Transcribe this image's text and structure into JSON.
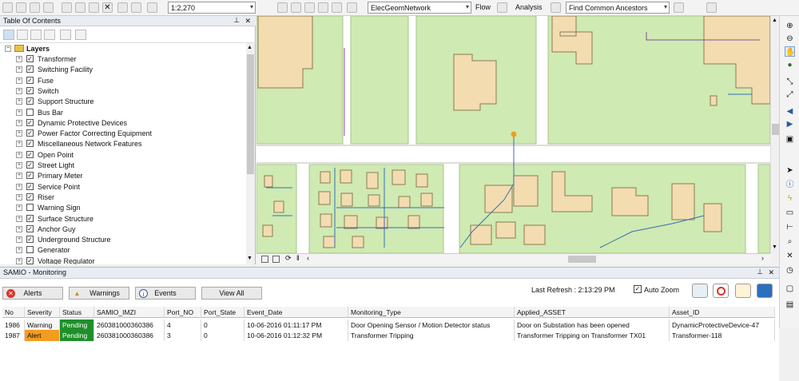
{
  "toolbar": {
    "scale": "1:2,270",
    "network": "ElecGeomNetwork",
    "flow": "Flow",
    "analysis": "Analysis",
    "find": "Find Common Ancestors"
  },
  "toc": {
    "title": "Table Of Contents",
    "pin": "✕",
    "root": "Layers",
    "layers": [
      "Transformer",
      "Switching Facility",
      "Fuse",
      "Switch",
      "Support Structure",
      "Bus Bar",
      "Dynamic Protective Devices",
      "Power Factor Correcting Equipment",
      "Miscellaneous Network Features",
      "Open Point",
      "Street Light",
      "Primary Meter",
      "Service Point",
      "Riser",
      "Warning Sign",
      "Surface Structure",
      "Anchor Guy",
      "Underground Structure",
      "Generator",
      "Voltage Regulator"
    ],
    "unchecked": [
      5,
      14,
      18
    ]
  },
  "monitor": {
    "title": "SAMIO - Monitoring",
    "buttons": {
      "alerts": "Alerts",
      "warnings": "Warnings",
      "events": "Events",
      "view_all": "View All"
    },
    "last_refresh": "Last Refresh : 2:13:29 PM",
    "auto_zoom": "Auto Zoom",
    "columns": [
      "No",
      "Severity",
      "Status",
      "SAMIO_IMZI",
      "Port_NO",
      "Port_State",
      "Event_Date",
      "Monitoring_Type",
      "Applied_ASSET",
      "Asset_ID"
    ],
    "rows": [
      [
        "1986",
        "Warning",
        "Pending",
        "260381000360386",
        "4",
        "0",
        "10-06-2016 01:11:17 PM",
        "Door Opening Sensor / Motion Detector status",
        "Door on Substation  has been opened",
        "DynamicProtectiveDevice-47"
      ],
      [
        "1987",
        "Alert",
        "Pending",
        "260381000360386",
        "3",
        "0",
        "10-06-2016 01:12:32 PM",
        "Transformer Tripping",
        "Transformer Tripping on Transformer TX01",
        "Transformer-118"
      ]
    ]
  },
  "colors": {
    "parcel": "#cfeab2",
    "building": "#f2dcb0",
    "line": "#3a6db0",
    "alert": "#f39c1f",
    "pending": "#1f8f2a"
  }
}
